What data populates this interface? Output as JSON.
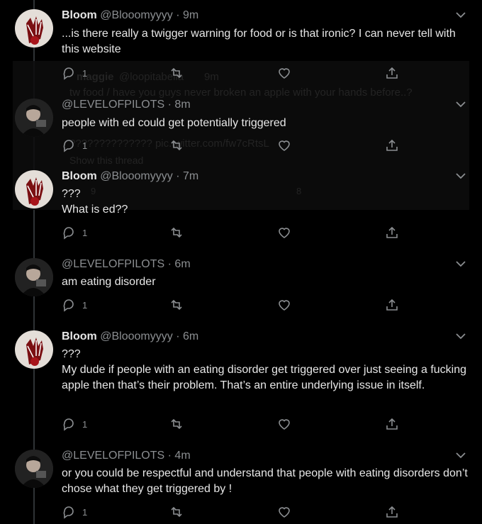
{
  "ghost_tweet": {
    "name": "maggie",
    "handle": "@loopitabella",
    "time": "9m",
    "text": "tw food / have you guys never broken an apple with your hands before..?",
    "text2": "?????????????? pic.twitter.com/fw7cRtsL",
    "show_thread": "Show this thread",
    "reply_count": "9",
    "retweet_count": "",
    "like_count": "8"
  },
  "tweets": [
    {
      "name": "Bloom",
      "handle": "@Blooomyyyy",
      "time": "9m",
      "lines": [
        "...is there really a twigger warning for food or is that ironic? I can never tell with this website"
      ],
      "reply_count": "1"
    },
    {
      "name": "",
      "handle": "@LEVELOFPILOTS",
      "time": "8m",
      "lines": [
        "people with ed could get potentially triggered"
      ],
      "reply_count": "1"
    },
    {
      "name": "Bloom",
      "handle": "@Blooomyyyy",
      "time": "7m",
      "lines": [
        "???",
        "What is ed??"
      ],
      "reply_count": "1"
    },
    {
      "name": "",
      "handle": "@LEVELOFPILOTS",
      "time": "6m",
      "lines": [
        "am eating disorder"
      ],
      "reply_count": "1"
    },
    {
      "name": "Bloom",
      "handle": "@Blooomyyyy",
      "time": "6m",
      "lines": [
        "???",
        "My dude if people with an eating disorder get triggered over just seeing a fucking apple then that’s their problem. That’s an entire underlying issue in itself."
      ],
      "reply_count": "1"
    },
    {
      "name": "",
      "handle": "@LEVELOFPILOTS",
      "time": "4m",
      "lines": [
        "or you could be respectful and understand that people with eating disorders don’t chose what they get triggered by !"
      ],
      "reply_count": "1"
    }
  ],
  "separator": "·",
  "colors": {
    "background": "#000000",
    "text": "#e7e7e7",
    "muted": "#8b8e91",
    "accent": "#c0392b"
  }
}
